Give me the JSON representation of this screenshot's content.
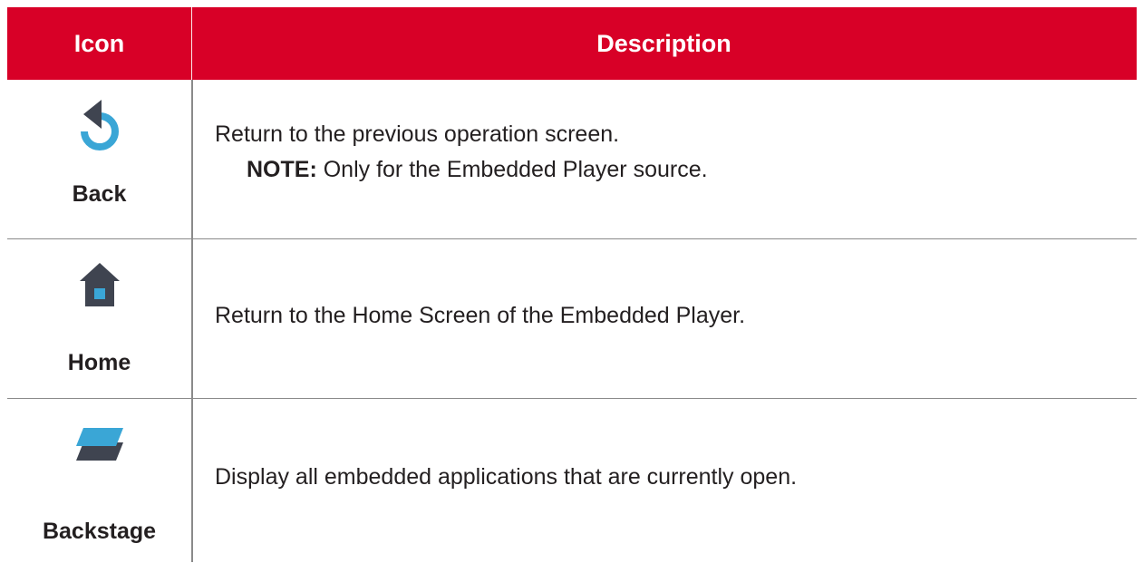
{
  "table": {
    "header": {
      "icon": "Icon",
      "description": "Description"
    },
    "rows": [
      {
        "icon_name": "back-icon",
        "label": "Back",
        "description": "Return to the previous operation screen.",
        "note_label": "NOTE:",
        "note_text": " Only for the Embedded Player source."
      },
      {
        "icon_name": "home-icon",
        "label": "Home",
        "description": "Return to the Home Screen of the Embedded Player."
      },
      {
        "icon_name": "backstage-icon",
        "label": "Backstage",
        "description": "Display all embedded applications that are currently open."
      }
    ]
  },
  "colors": {
    "header_bg": "#d80027",
    "icon_blue": "#3aa6d6",
    "icon_dark": "#3f4450",
    "grid": "#8a8a8a"
  }
}
